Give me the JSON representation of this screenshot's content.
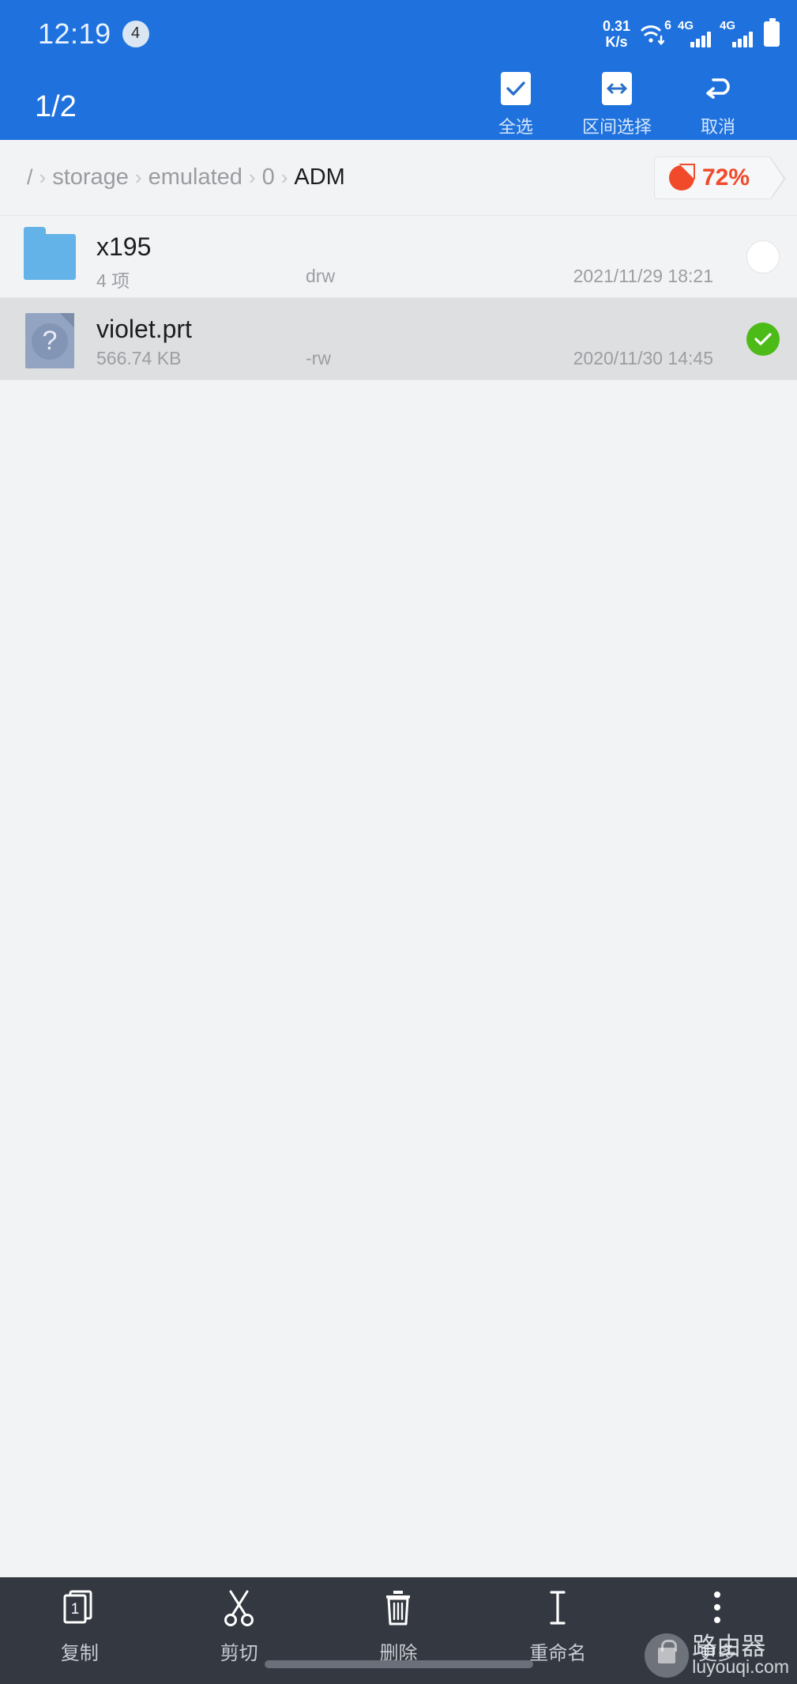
{
  "status_bar": {
    "time": "12:19",
    "notification_count": "4",
    "net_speed_value": "0.31",
    "net_speed_unit": "K/s",
    "wifi_generation": "6",
    "sim1_network": "4G",
    "sim2_network": "4G"
  },
  "header": {
    "selection_counter": "1/2",
    "accent_color": "#1f72dd",
    "actions": [
      {
        "id": "select-all",
        "label": "全选",
        "icon": "check-icon"
      },
      {
        "id": "range-select",
        "label": "区间选择",
        "icon": "left-right-arrow-icon"
      },
      {
        "id": "cancel",
        "label": "取消",
        "icon": "undo-arrow-icon"
      }
    ]
  },
  "breadcrumb": {
    "root": "/",
    "separator": "›",
    "segments": [
      {
        "label": "storage",
        "active": false
      },
      {
        "label": "emulated",
        "active": false
      },
      {
        "label": "0",
        "active": false
      },
      {
        "label": "ADM",
        "active": true
      }
    ],
    "storage_usage": {
      "percent_label": "72%",
      "color": "#f04a2a",
      "icon": "pie-chart-icon"
    }
  },
  "file_list": {
    "rows": [
      {
        "name": "x195",
        "meta": "4 项",
        "permissions": "drw",
        "date": "2021/11/29 18:21",
        "icon": "folder-icon",
        "selected": false
      },
      {
        "name": "violet.prt",
        "meta": "566.74 KB",
        "permissions": "-rw",
        "date": "2020/11/30 14:45",
        "icon": "unknown-file-icon",
        "selected": true
      }
    ]
  },
  "bottom_bar": {
    "background_color": "#343841",
    "items": [
      {
        "id": "copy",
        "label": "复制",
        "icon": "copy-stack-icon",
        "badge": "1"
      },
      {
        "id": "cut",
        "label": "剪切",
        "icon": "scissors-icon"
      },
      {
        "id": "delete",
        "label": "删除",
        "icon": "trash-icon"
      },
      {
        "id": "rename",
        "label": "重命名",
        "icon": "text-cursor-icon"
      },
      {
        "id": "more",
        "label": "更多",
        "icon": "vertical-dots-icon"
      }
    ]
  },
  "watermark": {
    "cn_text": "路由器",
    "en_text": "luyouqi.com"
  }
}
